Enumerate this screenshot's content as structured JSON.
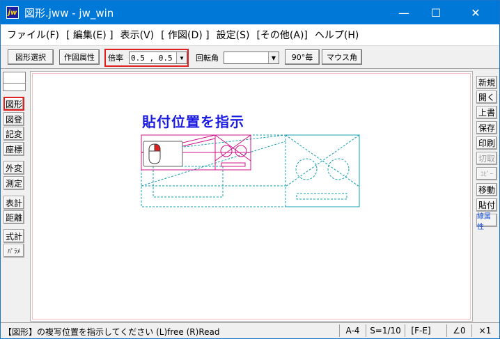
{
  "window": {
    "title": "図形.jww - jw_win",
    "app_icon_text": "jw",
    "minimize": "—",
    "maximize": "☐",
    "close": "✕"
  },
  "menu": [
    "ファイル(F)",
    "[ 編集(E) ]",
    "表示(V)",
    "[ 作図(D) ]",
    "設定(S)",
    "[その他(A)]",
    "ヘルプ(H)"
  ],
  "toolbar": {
    "select_figure": "図形選択",
    "drawing_attr": "作図属性",
    "scale_label": "倍率",
    "scale_value": "0.5 , 0.5",
    "rotation_label": "回転角",
    "rotation_value": "",
    "deg90": "90°毎",
    "mouse_angle": "マウス角",
    "dropdown_arrow": "▼"
  },
  "left_tools": [
    "図形",
    "図登",
    "記変",
    "座標",
    "外変",
    "測定",
    "表計",
    "距離",
    "式計",
    "ﾊﾟﾗﾒ"
  ],
  "right_tools": [
    "新規",
    "開く",
    "上書",
    "保存",
    "印刷",
    "切取",
    "ｺﾋﾟｰ",
    "移動",
    "貼付",
    "線属性"
  ],
  "canvas": {
    "prompt": "貼付位置を指示"
  },
  "status": {
    "message": "【図形】の複写位置を指示してください (L)free (R)Read",
    "paper": "A-4",
    "scale": "S=1/10",
    "layer": "[F-E]",
    "angle": "∠0",
    "zoom": "×1"
  },
  "colors": {
    "titlebar": "#0078d7",
    "highlight": "#e02020",
    "prompt": "#1a1ae0",
    "figure": "#d0108a",
    "dashed": "#14a0b0"
  }
}
